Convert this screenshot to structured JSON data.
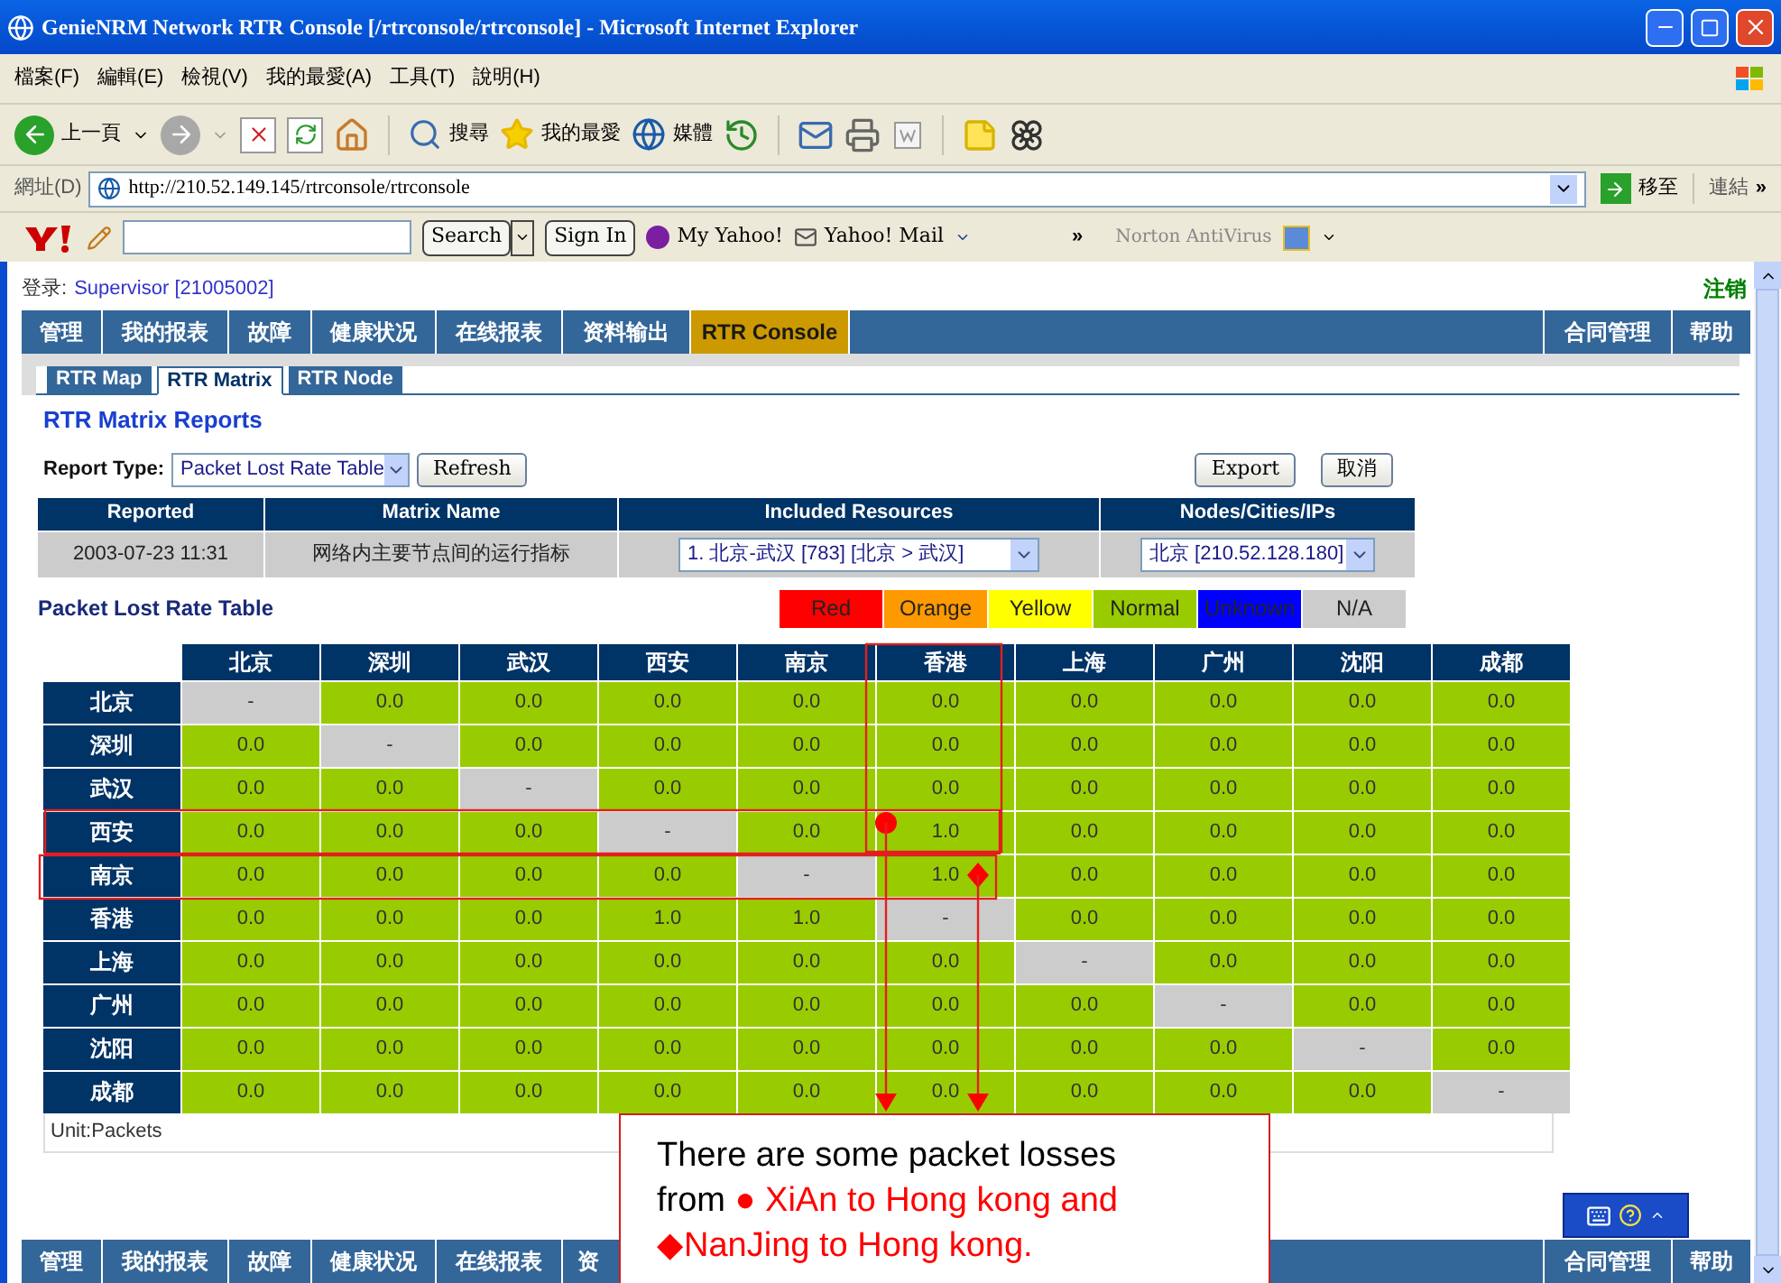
{
  "window": {
    "title": "GenieNRM Network RTR Console [/rtrconsole/rtrconsole] - Microsoft Internet Explorer"
  },
  "menu": [
    "檔案(F)",
    "編輯(E)",
    "檢視(V)",
    "我的最愛(A)",
    "工具(T)",
    "說明(H)"
  ],
  "toolbar": {
    "back": "上一頁",
    "search": "搜尋",
    "favorites": "我的最愛",
    "media": "媒體"
  },
  "address": {
    "label": "網址(D)",
    "url": "http://210.52.149.145/rtrconsole/rtrconsole",
    "go": "移至",
    "links": "連結",
    "more": "»"
  },
  "yahoo_bar": {
    "search": "Search",
    "sign_in": "Sign In",
    "my_yahoo": "My Yahoo!",
    "mail": "Yahoo! Mail",
    "more": "»",
    "norton": "Norton AntiVirus"
  },
  "login": {
    "label": "登录:",
    "user": "Supervisor [21005002]",
    "logout": "注销"
  },
  "nav": {
    "left": [
      {
        "label": "管理",
        "selected": false
      },
      {
        "label": "我的报表",
        "selected": false
      },
      {
        "label": "故障",
        "selected": false
      },
      {
        "label": "健康状况",
        "selected": false
      },
      {
        "label": "在线报表",
        "selected": false
      },
      {
        "label": "资料输出",
        "selected": false
      },
      {
        "label": "RTR Console",
        "selected": true
      }
    ],
    "right": [
      {
        "label": "合同管理",
        "selected": false
      },
      {
        "label": "帮助",
        "selected": false
      }
    ]
  },
  "tabs": [
    {
      "label": "RTR Map",
      "selected": false
    },
    {
      "label": "RTR Matrix",
      "selected": true
    },
    {
      "label": "RTR Node",
      "selected": false
    }
  ],
  "heading": "RTR Matrix Reports",
  "report_type": {
    "label": "Report Type:",
    "value": "Packet Lost Rate Table"
  },
  "buttons": {
    "refresh": "Refresh",
    "export": "Export",
    "cancel": "取消"
  },
  "summary": {
    "columns": [
      "Reported",
      "Matrix Name",
      "Included Resources",
      "Nodes/Cities/IPs"
    ],
    "reported": "2003-07-23 11:31",
    "matrix_name": "网络内主要节点间的运行指标",
    "resource": "1. 北京-武汉 [783] [北京 > 武汉]",
    "node": "北京 [210.52.128.180]"
  },
  "legend": {
    "title": "Packet Lost Rate Table",
    "items": [
      {
        "label": "Red",
        "color": "#ff0000"
      },
      {
        "label": "Orange",
        "color": "#ff9900"
      },
      {
        "label": "Yellow",
        "color": "#ffff00"
      },
      {
        "label": "Normal",
        "color": "#99cc00"
      },
      {
        "label": "Unknown",
        "color": "#0000ff"
      },
      {
        "label": "N/A",
        "color": "#cccccc"
      }
    ]
  },
  "matrix": {
    "columns": [
      "北京",
      "深圳",
      "武汉",
      "西安",
      "南京",
      "香港",
      "上海",
      "广州",
      "沈阳",
      "成都"
    ],
    "rows": [
      {
        "label": "北京",
        "cells": [
          {
            "value": "-",
            "kind": "na"
          },
          {
            "value": "0.0",
            "kind": "normal"
          },
          {
            "value": "0.0",
            "kind": "normal"
          },
          {
            "value": "0.0",
            "kind": "normal"
          },
          {
            "value": "0.0",
            "kind": "normal"
          },
          {
            "value": "0.0",
            "kind": "normal"
          },
          {
            "value": "0.0",
            "kind": "normal"
          },
          {
            "value": "0.0",
            "kind": "normal"
          },
          {
            "value": "0.0",
            "kind": "normal"
          },
          {
            "value": "0.0",
            "kind": "normal"
          }
        ]
      },
      {
        "label": "深圳",
        "cells": [
          {
            "value": "0.0",
            "kind": "normal"
          },
          {
            "value": "-",
            "kind": "na"
          },
          {
            "value": "0.0",
            "kind": "normal"
          },
          {
            "value": "0.0",
            "kind": "normal"
          },
          {
            "value": "0.0",
            "kind": "normal"
          },
          {
            "value": "0.0",
            "kind": "normal"
          },
          {
            "value": "0.0",
            "kind": "normal"
          },
          {
            "value": "0.0",
            "kind": "normal"
          },
          {
            "value": "0.0",
            "kind": "normal"
          },
          {
            "value": "0.0",
            "kind": "normal"
          }
        ]
      },
      {
        "label": "武汉",
        "cells": [
          {
            "value": "0.0",
            "kind": "normal"
          },
          {
            "value": "0.0",
            "kind": "normal"
          },
          {
            "value": "-",
            "kind": "na"
          },
          {
            "value": "0.0",
            "kind": "normal"
          },
          {
            "value": "0.0",
            "kind": "normal"
          },
          {
            "value": "0.0",
            "kind": "normal"
          },
          {
            "value": "0.0",
            "kind": "normal"
          },
          {
            "value": "0.0",
            "kind": "normal"
          },
          {
            "value": "0.0",
            "kind": "normal"
          },
          {
            "value": "0.0",
            "kind": "normal"
          }
        ]
      },
      {
        "label": "西安",
        "cells": [
          {
            "value": "0.0",
            "kind": "normal"
          },
          {
            "value": "0.0",
            "kind": "normal"
          },
          {
            "value": "0.0",
            "kind": "normal"
          },
          {
            "value": "-",
            "kind": "na"
          },
          {
            "value": "0.0",
            "kind": "normal"
          },
          {
            "value": "1.0",
            "kind": "normal"
          },
          {
            "value": "0.0",
            "kind": "normal"
          },
          {
            "value": "0.0",
            "kind": "normal"
          },
          {
            "value": "0.0",
            "kind": "normal"
          },
          {
            "value": "0.0",
            "kind": "normal"
          }
        ]
      },
      {
        "label": "南京",
        "cells": [
          {
            "value": "0.0",
            "kind": "normal"
          },
          {
            "value": "0.0",
            "kind": "normal"
          },
          {
            "value": "0.0",
            "kind": "normal"
          },
          {
            "value": "0.0",
            "kind": "normal"
          },
          {
            "value": "-",
            "kind": "na"
          },
          {
            "value": "1.0",
            "kind": "normal"
          },
          {
            "value": "0.0",
            "kind": "normal"
          },
          {
            "value": "0.0",
            "kind": "normal"
          },
          {
            "value": "0.0",
            "kind": "normal"
          },
          {
            "value": "0.0",
            "kind": "normal"
          }
        ]
      },
      {
        "label": "香港",
        "cells": [
          {
            "value": "0.0",
            "kind": "normal"
          },
          {
            "value": "0.0",
            "kind": "normal"
          },
          {
            "value": "0.0",
            "kind": "normal"
          },
          {
            "value": "1.0",
            "kind": "normal"
          },
          {
            "value": "1.0",
            "kind": "normal"
          },
          {
            "value": "-",
            "kind": "na"
          },
          {
            "value": "0.0",
            "kind": "normal"
          },
          {
            "value": "0.0",
            "kind": "normal"
          },
          {
            "value": "0.0",
            "kind": "normal"
          },
          {
            "value": "0.0",
            "kind": "normal"
          }
        ]
      },
      {
        "label": "上海",
        "cells": [
          {
            "value": "0.0",
            "kind": "normal"
          },
          {
            "value": "0.0",
            "kind": "normal"
          },
          {
            "value": "0.0",
            "kind": "normal"
          },
          {
            "value": "0.0",
            "kind": "normal"
          },
          {
            "value": "0.0",
            "kind": "normal"
          },
          {
            "value": "0.0",
            "kind": "normal"
          },
          {
            "value": "-",
            "kind": "na"
          },
          {
            "value": "0.0",
            "kind": "normal"
          },
          {
            "value": "0.0",
            "kind": "normal"
          },
          {
            "value": "0.0",
            "kind": "normal"
          }
        ]
      },
      {
        "label": "广州",
        "cells": [
          {
            "value": "0.0",
            "kind": "normal"
          },
          {
            "value": "0.0",
            "kind": "normal"
          },
          {
            "value": "0.0",
            "kind": "normal"
          },
          {
            "value": "0.0",
            "kind": "normal"
          },
          {
            "value": "0.0",
            "kind": "normal"
          },
          {
            "value": "0.0",
            "kind": "normal"
          },
          {
            "value": "0.0",
            "kind": "normal"
          },
          {
            "value": "-",
            "kind": "na"
          },
          {
            "value": "0.0",
            "kind": "normal"
          },
          {
            "value": "0.0",
            "kind": "normal"
          }
        ]
      },
      {
        "label": "沈阳",
        "cells": [
          {
            "value": "0.0",
            "kind": "normal"
          },
          {
            "value": "0.0",
            "kind": "normal"
          },
          {
            "value": "0.0",
            "kind": "normal"
          },
          {
            "value": "0.0",
            "kind": "normal"
          },
          {
            "value": "0.0",
            "kind": "normal"
          },
          {
            "value": "0.0",
            "kind": "normal"
          },
          {
            "value": "0.0",
            "kind": "normal"
          },
          {
            "value": "0.0",
            "kind": "normal"
          },
          {
            "value": "-",
            "kind": "na"
          },
          {
            "value": "0.0",
            "kind": "normal"
          }
        ]
      },
      {
        "label": "成都",
        "cells": [
          {
            "value": "0.0",
            "kind": "normal"
          },
          {
            "value": "0.0",
            "kind": "normal"
          },
          {
            "value": "0.0",
            "kind": "normal"
          },
          {
            "value": "0.0",
            "kind": "normal"
          },
          {
            "value": "0.0",
            "kind": "normal"
          },
          {
            "value": "0.0",
            "kind": "normal"
          },
          {
            "value": "0.0",
            "kind": "normal"
          },
          {
            "value": "0.0",
            "kind": "normal"
          },
          {
            "value": "0.0",
            "kind": "normal"
          },
          {
            "value": "-",
            "kind": "na"
          }
        ]
      }
    ]
  },
  "unit": "Unit:Packets",
  "callout": {
    "lines": [
      [
        {
          "text": "There are some packet losses",
          "color": "#000000"
        }
      ],
      [
        {
          "text": "from ",
          "color": "#000000"
        },
        {
          "text": "● XiAn to Hong kong and",
          "color": "#ff0000"
        }
      ],
      [
        {
          "text": "◆NanJing to Hong kong.",
          "color": "#ff0000"
        }
      ]
    ]
  },
  "bottom_nav_x": {
    "left": [
      "管理",
      "我的报表",
      "故障",
      "健康状况",
      "在线报表",
      "资"
    ],
    "right": [
      "合同管理",
      "帮助"
    ]
  }
}
